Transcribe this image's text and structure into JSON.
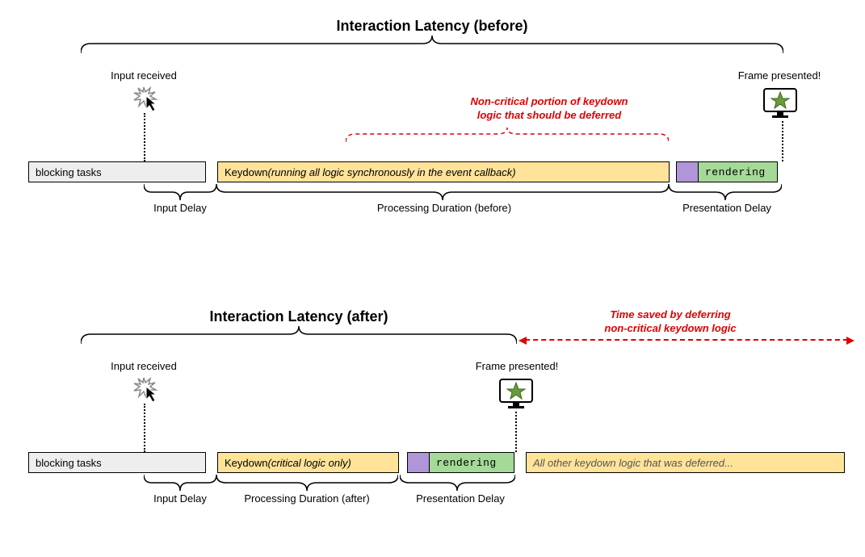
{
  "before": {
    "title": "Interaction Latency (before)",
    "input_received": "Input received",
    "blocking_tasks": "blocking tasks",
    "keydown_prefix": "Keydown ",
    "keydown_suffix": "(running all logic synchronously in the event callback)",
    "rendering": "rendering",
    "frame_presented": "Frame presented!",
    "callout_line1": "Non-critical portion of keydown",
    "callout_line2": "logic that should be deferred",
    "input_delay": "Input Delay",
    "processing_duration": "Processing Duration (before)",
    "presentation_delay": "Presentation Delay"
  },
  "after": {
    "title": "Interaction Latency (after)",
    "input_received": "Input received",
    "blocking_tasks": "blocking tasks",
    "keydown_prefix": "Keydown ",
    "keydown_suffix": "(critical logic only)",
    "rendering": "rendering",
    "frame_presented": "Frame presented!",
    "deferred": "All other keydown logic that was deferred...",
    "callout_line1": "Time saved by deferring",
    "callout_line2": "non-critical keydown logic",
    "input_delay": "Input Delay",
    "processing_duration": "Processing Duration (after)",
    "presentation_delay": "Presentation Delay"
  }
}
